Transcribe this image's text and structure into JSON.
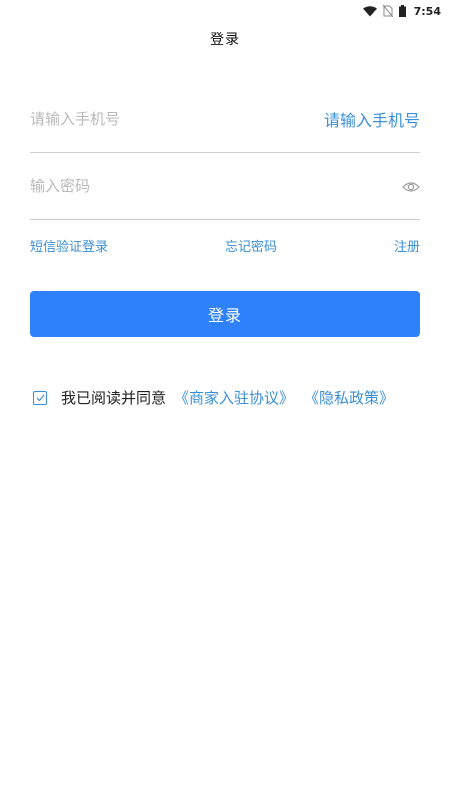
{
  "status_bar": {
    "time": "7:54",
    "icons": [
      "wifi-icon",
      "no-sim-icon",
      "battery-icon"
    ]
  },
  "header": {
    "title": "登录"
  },
  "form": {
    "phone": {
      "placeholder": "请输入手机号",
      "value": "",
      "right_label": "请输入手机号"
    },
    "password": {
      "placeholder": "输入密码",
      "value": "",
      "toggle_icon": "eye-icon"
    }
  },
  "links": {
    "sms_login": "短信验证登录",
    "forgot_password": "忘记密码",
    "register": "注册"
  },
  "login_button": {
    "label": "登录"
  },
  "agreement": {
    "checked": true,
    "prefix": "我已阅读并同意",
    "merchant_agreement": "《商家入驻协议》",
    "privacy_policy": "《隐私政策》"
  },
  "colors": {
    "accent": "#3b8fd6",
    "button": "#2f80fb",
    "placeholder": "#b9b9b9",
    "divider": "#cfcfcf"
  }
}
